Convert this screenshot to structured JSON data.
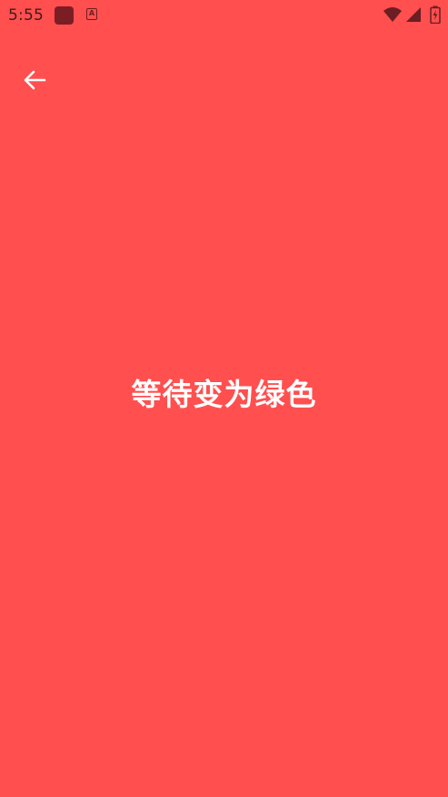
{
  "status_bar": {
    "time": "5:55",
    "notification_badge_letter": "A",
    "icons": [
      "app-notification-icon",
      "a-notification-icon",
      "wifi-icon",
      "signal-icon",
      "battery-icon"
    ]
  },
  "toolbar": {
    "back_icon": "arrow-left-icon"
  },
  "main": {
    "message": "等待变为绿色"
  },
  "colors": {
    "background": "#FF4F4F",
    "status_icons": "#6B1E23",
    "text": "#FFFFFF"
  }
}
